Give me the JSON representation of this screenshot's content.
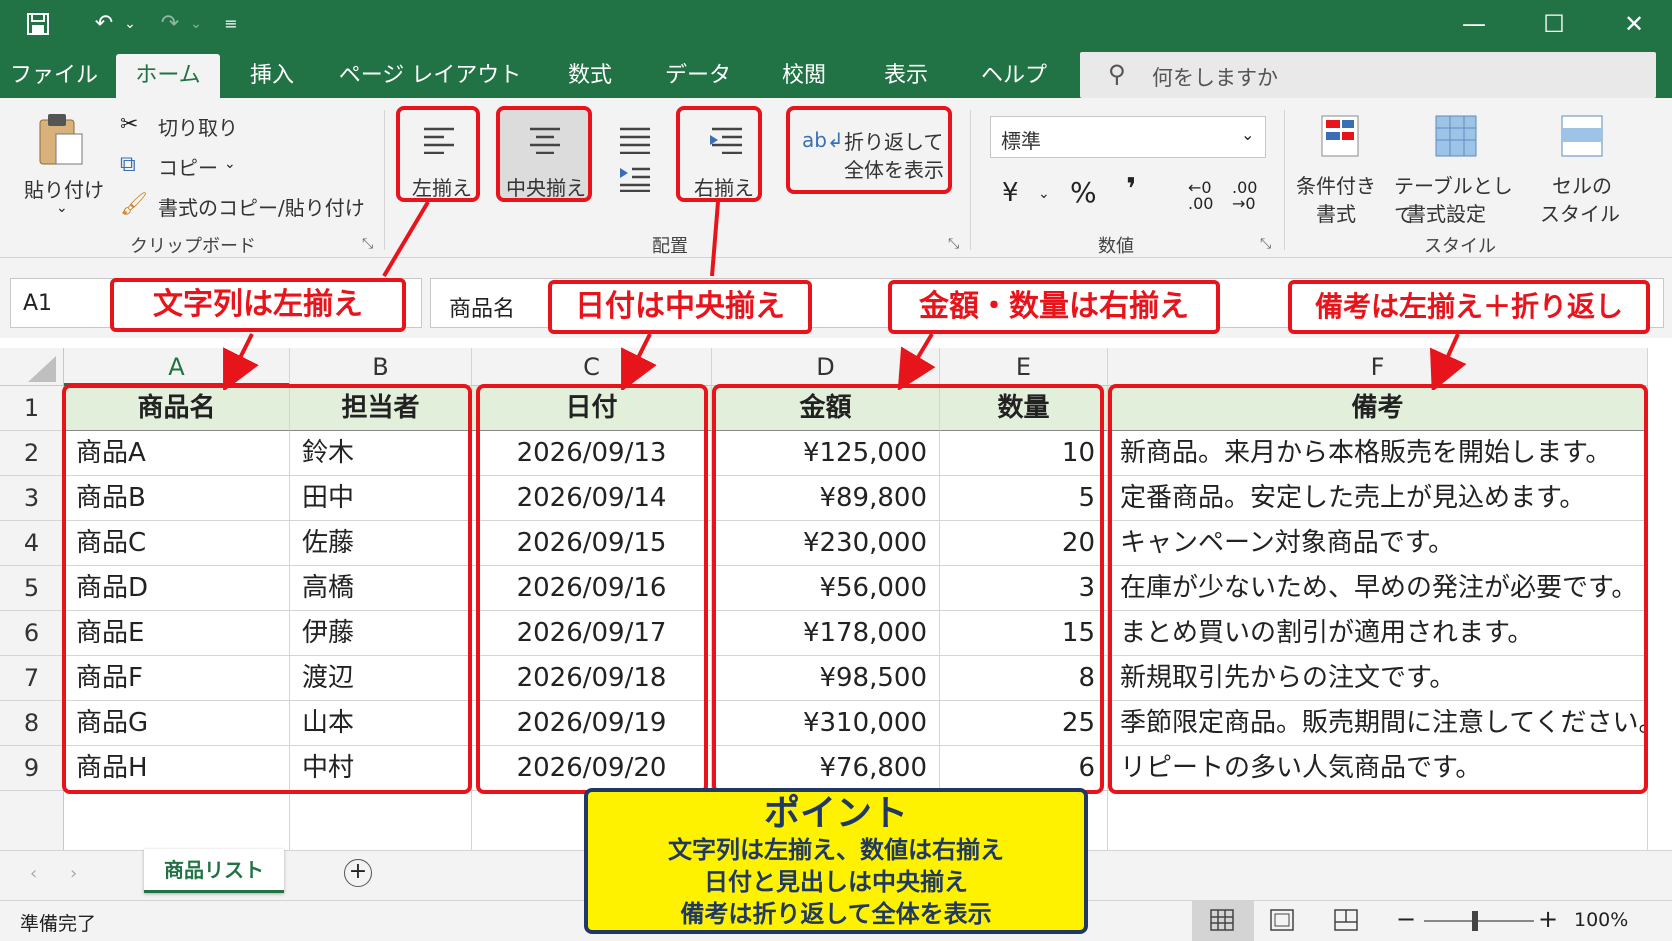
{
  "qat": {
    "save_icon": "save-icon",
    "undo_icon": "undo-icon",
    "redo_icon": "redo-icon",
    "customize_icon": "customize-icon"
  },
  "window": {
    "minimize": "—",
    "maximize": "☐",
    "close": "✕"
  },
  "tabs": [
    "ファイル",
    "ホーム",
    "挿入",
    "ページ レイアウト",
    "数式",
    "データ",
    "校閲",
    "表示",
    "ヘルプ"
  ],
  "active_tab": "ホーム",
  "tellme": {
    "placeholder": "何をしますか"
  },
  "clipboard": {
    "paste": "貼り付け",
    "cut": "切り取り",
    "copy": "コピー",
    "format_painter": "書式のコピー/貼り付け",
    "group": "クリップボード"
  },
  "alignment": {
    "left": "左揃え",
    "center": "中央揃え",
    "right": "右揃え",
    "wrap_line1": "折り返して",
    "wrap_line2": "全体を表示",
    "group": "配置"
  },
  "number": {
    "format": "標準",
    "yen": "¥",
    "percent": "%",
    "comma": "❜",
    "inc": "←0 .00",
    "dec": ".00 →0",
    "group": "数値"
  },
  "styles": {
    "cond_line1": "条件付き",
    "cond_line2": "書式",
    "table_line1": "テーブルとして",
    "table_line2": "書式設定",
    "cell_line1": "セルの",
    "cell_line2": "スタイル",
    "group": "スタイル"
  },
  "namebox": "A1",
  "formula": "商品名",
  "annotations": {
    "a": "文字列は左揃え",
    "c": "日付は中央揃え",
    "d": "金額・数量は右揃え",
    "f": "備考は左揃え＋折り返し"
  },
  "columns": [
    "A",
    "B",
    "C",
    "D",
    "E",
    "F"
  ],
  "rows": [
    "1",
    "2",
    "3",
    "4",
    "5",
    "6",
    "7",
    "8",
    "9"
  ],
  "headers": [
    "商品名",
    "担当者",
    "日付",
    "金額",
    "数量",
    "備考"
  ],
  "table": [
    [
      "商品A",
      "鈴木",
      "2026/09/13",
      "¥125,000",
      "10",
      "新商品。来月から本格販売を開始します。"
    ],
    [
      "商品B",
      "田中",
      "2026/09/14",
      "¥89,800",
      "5",
      "定番商品。安定した売上が見込めます。"
    ],
    [
      "商品C",
      "佐藤",
      "2026/09/15",
      "¥230,000",
      "20",
      "キャンペーン対象商品です。"
    ],
    [
      "商品D",
      "高橋",
      "2026/09/16",
      "¥56,000",
      "3",
      "在庫が少ないため、早めの発注が必要です。"
    ],
    [
      "商品E",
      "伊藤",
      "2026/09/17",
      "¥178,000",
      "15",
      "まとめ買いの割引が適用されます。"
    ],
    [
      "商品F",
      "渡辺",
      "2026/09/18",
      "¥98,500",
      "8",
      "新規取引先からの注文です。"
    ],
    [
      "商品G",
      "山本",
      "2026/09/19",
      "¥310,000",
      "25",
      "季節限定商品。販売期間に注意してください。"
    ],
    [
      "商品H",
      "中村",
      "2026/09/20",
      "¥76,800",
      "6",
      "リピートの多い人気商品です。"
    ]
  ],
  "point": {
    "title": "ポイント",
    "line1": "文字列は左揃え、数値は右揃え",
    "line2": "日付と見出しは中央揃え",
    "line3": "備考は折り返して全体を表示"
  },
  "sheet_tab": "商品リスト",
  "status": "準備完了",
  "zoom": "100%",
  "colors": {
    "excel_green": "#217346",
    "highlight_red": "#e8141c",
    "point_yellow": "#fff200",
    "point_navy": "#1f3864",
    "header_fill": "#e2efda"
  }
}
